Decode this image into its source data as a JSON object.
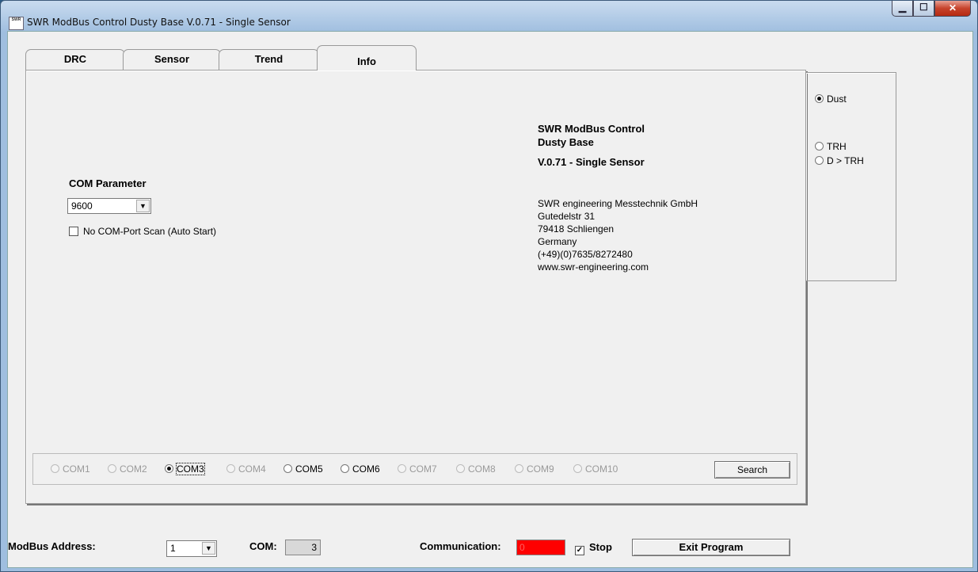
{
  "window": {
    "title": "SWR ModBus Control Dusty Base V.0.71 - Single Sensor",
    "icon_text": "SWR",
    "minimize_glyph": "▁",
    "maximize_glyph": "☐",
    "close_glyph": "✕"
  },
  "tabs": [
    {
      "label": "DRC",
      "active": false
    },
    {
      "label": "Sensor",
      "active": false
    },
    {
      "label": "Trend",
      "active": false
    },
    {
      "label": "Info",
      "active": true
    }
  ],
  "info": {
    "com_parameter_label": "COM Parameter",
    "baud_value": "9600",
    "no_scan_label": "No COM-Port Scan (Auto Start)",
    "no_scan_checked": false,
    "product_line1": "SWR ModBus Control",
    "product_line2": "Dusty Base",
    "version": "V.0.71 - Single Sensor",
    "company": "SWR engineering Messtechnik GmbH",
    "street": "Gutedelstr 31",
    "city": "79418 Schliengen",
    "country": "Germany",
    "phone": "(+49)(0)7635/8272480",
    "web": "www.swr-engineering.com"
  },
  "com_ports": [
    {
      "label": "COM1",
      "enabled": false,
      "selected": false
    },
    {
      "label": "COM2",
      "enabled": false,
      "selected": false
    },
    {
      "label": "COM3",
      "enabled": true,
      "selected": true
    },
    {
      "label": "COM4",
      "enabled": false,
      "selected": false
    },
    {
      "label": "COM5",
      "enabled": true,
      "selected": false
    },
    {
      "label": "COM6",
      "enabled": true,
      "selected": false
    },
    {
      "label": "COM7",
      "enabled": false,
      "selected": false
    },
    {
      "label": "COM8",
      "enabled": false,
      "selected": false
    },
    {
      "label": "COM9",
      "enabled": false,
      "selected": false
    },
    {
      "label": "COM10",
      "enabled": false,
      "selected": false
    }
  ],
  "search_button": "Search",
  "mode": {
    "dust": "Dust",
    "trh": "TRH",
    "d_trh": "D > TRH",
    "selected": "Dust"
  },
  "footer": {
    "modbus_label": "ModBus Address:",
    "modbus_value": "1",
    "com_label": "COM:",
    "com_value": "3",
    "communication_label": "Communication:",
    "communication_value": "0",
    "communication_color": "#ff0000",
    "stop_label": "Stop",
    "stop_checked": true,
    "check_glyph": "✓",
    "exit_label": "Exit Program"
  },
  "combo_arrow": "▼"
}
